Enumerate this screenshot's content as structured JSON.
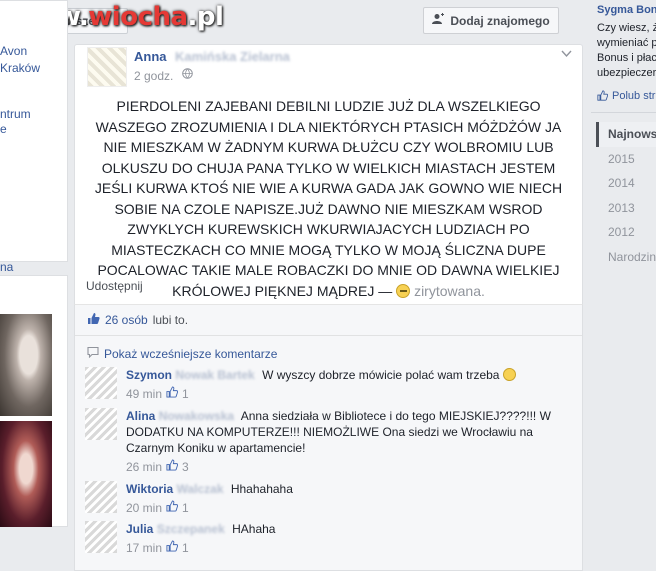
{
  "header": {
    "sort_prefix": "su",
    "sort_caret": "▼",
    "sort_selected": "Najnowsze",
    "add_friend_label": "Dodaj znajomego",
    "add_friend_icon": "add-friend-icon"
  },
  "watermark": {
    "part1": "www.",
    "part2": "wiocha",
    "part3": ".pl"
  },
  "left": {
    "links": [
      "Avon",
      "Kraków",
      "ntrum",
      "e",
      "na"
    ]
  },
  "post": {
    "author": "Anna",
    "author_blurred": "Kamińska Zielarna",
    "time": "2 godz.",
    "text": "PIERDOLENI ZAJEBANI DEBILNI LUDZIE JUŻ DLA WSZELKIEGO WASZEGO ZROZUMIENIA I DLA NIEKTÓRYCH PTASICH MÓŻDŻÓW JA NIE MIESZKAM W ŻADNYM KURWA DŁUŻCU CZY WOLBROMIU LUB OLKUSZU DO CHUJA PANA TYLKO W WIELKICH MIASTACH JESTEM JEŚLI KURWA KTOŚ NIE WIE A KURWA GADA JAK GOWNO WIE NIECH SOBIE NA CZOLE NAPISZE.JUŻ DAWNO NIE MIESZKAM WSROD ZWYKLYCH KUREWSKICH WKURWIAJACYCH LUDZIACH PO MIASTECZKACH CO MNIE MOGĄ TYLKO W MOJĄ ŚLICZNA DUPE POCALOWAC TAKIE MALE ROBACZKI DO MNIE OD DAWNA WIELKIEJ KRÓLOWEJ PIĘKNEJ MĄDREJ —",
    "mood": "zirytowana.",
    "share": "Udostępnij"
  },
  "engagement": {
    "likes_count": "26 osób",
    "likes_suffix": "lubi to.",
    "prev_comments": "Pokaż wcześniejsze komentarze"
  },
  "comments": [
    {
      "author": "Szymon",
      "blurred": "Nowak Bartek",
      "text": "W wyszcy dobrze mówicie polać wam trzeba",
      "time": "49 min",
      "likes": "1",
      "has_smile": true
    },
    {
      "author": "Alina",
      "blurred": "Nowakowska",
      "text": "Anna siedziała w Bibliotece i do tego MIEJSKIEJ????!!! W DODATKU NA KOMPUTERZE!!! NIEMOŻLIWE Ona siedzi we Wrocławiu na Czarnym Koniku w apartamencie!",
      "time": "26 min",
      "likes": "3",
      "has_smile": false
    },
    {
      "author": "Wiktoria",
      "blurred": "Walczak",
      "text": "Hhahahaha",
      "time": "20 min",
      "likes": "1",
      "has_smile": false
    },
    {
      "author": "Julia",
      "blurred": "Szczepanek",
      "text": "HAhaha",
      "time": "17 min",
      "likes": "1",
      "has_smile": false
    }
  ],
  "right": {
    "title": "Sygma Bon",
    "text_lines": [
      "Czy wiesz, ż",
      "wymieniać p",
      "Bonus i płac",
      "ubezpieczer"
    ],
    "like_label": "Polub str",
    "years": [
      "Najnows",
      "2015",
      "2014",
      "2013",
      "2012",
      "Narodzin"
    ]
  },
  "colors": {
    "link": "#365899",
    "like_blue": "#4267b2",
    "muted": "#90949c",
    "background": "#e9ebee"
  }
}
